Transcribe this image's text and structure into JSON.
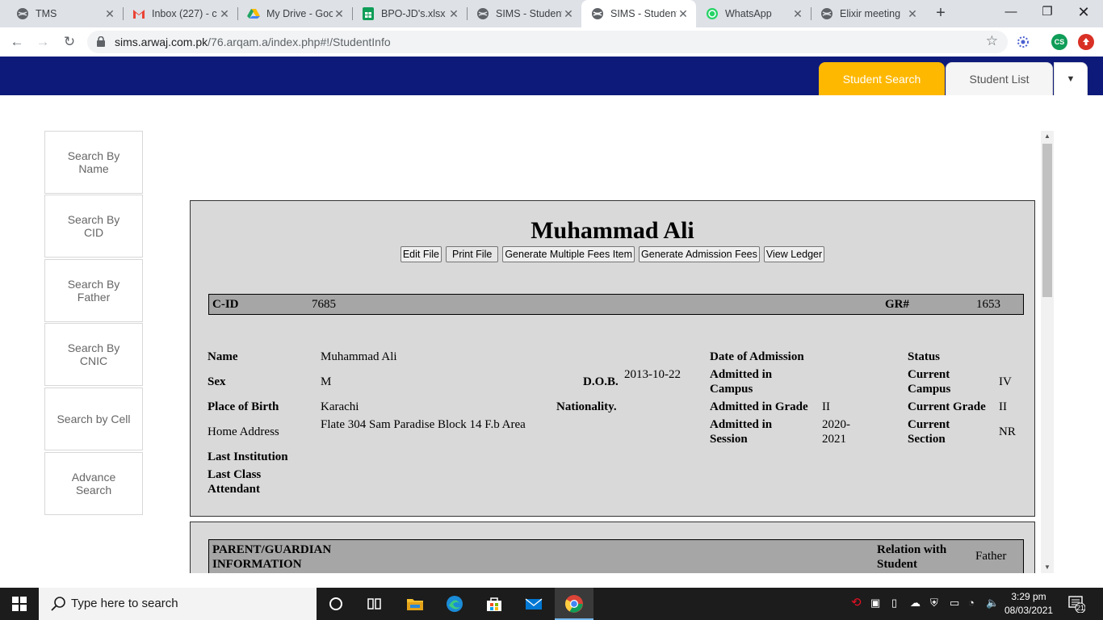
{
  "browser": {
    "tabs": [
      {
        "title": "TMS",
        "icon": "globe-icon"
      },
      {
        "title": "Inbox (227) - c",
        "icon": "gmail-icon"
      },
      {
        "title": "My Drive - Goo",
        "icon": "google-drive-icon"
      },
      {
        "title": "BPO-JD's.xlsx -",
        "icon": "google-sheets-icon"
      },
      {
        "title": "SIMS - Student",
        "icon": "globe-icon"
      },
      {
        "title": "SIMS - Student",
        "icon": "globe-icon"
      },
      {
        "title": "WhatsApp",
        "icon": "whatsapp-icon"
      },
      {
        "title": "Elixir meeting",
        "icon": "globe-icon"
      }
    ],
    "url_host": "sims.arwaj.com.pk",
    "url_path": "/76.arqam.a/index.php#!/StudentInfo",
    "profile_initials": "CS"
  },
  "nav": {
    "student_search": "Student Search",
    "student_list": "Student List"
  },
  "sidebar": [
    {
      "label": "Search By Name"
    },
    {
      "label": "Search By CID"
    },
    {
      "label": "Search By Father"
    },
    {
      "label": "Search By CNIC"
    },
    {
      "label": "Search by Cell"
    },
    {
      "label": "Advance Search"
    }
  ],
  "student": {
    "name": "Muhammad Ali",
    "actions": {
      "edit": "Edit File",
      "print": "Print File",
      "multi_fees": "Generate Multiple Fees Item",
      "admission_fees": "Generate Admission Fees",
      "ledger": "View Ledger"
    },
    "cid_label": "C-ID",
    "cid": "7685",
    "gr_label": "GR#",
    "gr": "1653",
    "labels": {
      "name": "Name",
      "sex": "Sex",
      "place_of_birth": "Place of Birth",
      "home_address": "Home Address",
      "last_institution": "Last Institution",
      "last_class": "Last Class Attendant",
      "dob": "D.O.B.",
      "nationality": "Nationality.",
      "date_of_admission": "Date of Admission",
      "admitted_campus": "Admitted in Campus",
      "admitted_grade": "Admitted in Grade",
      "admitted_session": "Admitted in Session",
      "status": "Status",
      "current_campus": "Current Campus",
      "current_grade": "Current Grade",
      "current_section": "Current Section"
    },
    "values": {
      "name": "Muhammad Ali",
      "sex": "M",
      "place_of_birth": "Karachi",
      "home_address": "Flate 304 Sam Paradise Block 14 F.b Area",
      "dob": "2013-10-22",
      "admitted_grade": "II",
      "admitted_session": "2020-2021",
      "current_campus": "IV",
      "current_grade": "II",
      "current_section": "NR"
    }
  },
  "parent": {
    "heading": "PARENT/GUARDIAN INFORMATION",
    "relation_label": "Relation with Student",
    "relation": "Father"
  },
  "taskbar": {
    "search_placeholder": "Type here to search",
    "time": "3:29 pm",
    "date": "08/03/2021",
    "notification_count": "21"
  },
  "colors": {
    "header": "#0d1a7a",
    "accent": "#ffb800",
    "panel": "#d9d9d9",
    "idbar": "#a6a6a6"
  }
}
